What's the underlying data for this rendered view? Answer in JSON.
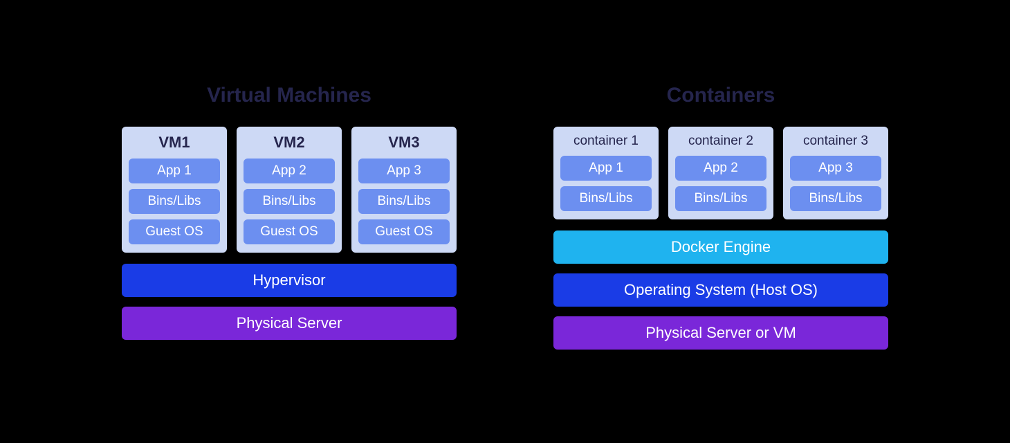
{
  "vm": {
    "title": "Virtual Machines",
    "units": [
      {
        "name": "VM1",
        "app": "App 1",
        "bins": "Bins/Libs",
        "os": "Guest OS"
      },
      {
        "name": "VM2",
        "app": "App 2",
        "bins": "Bins/Libs",
        "os": "Guest OS"
      },
      {
        "name": "VM3",
        "app": "App 3",
        "bins": "Bins/Libs",
        "os": "Guest OS"
      }
    ],
    "hypervisor": "Hypervisor",
    "server": "Physical Server"
  },
  "ctr": {
    "title": "Containers",
    "units": [
      {
        "name": "container 1",
        "app": "App 1",
        "bins": "Bins/Libs"
      },
      {
        "name": "container 2",
        "app": "App 2",
        "bins": "Bins/Libs"
      },
      {
        "name": "container 3",
        "app": "App 3",
        "bins": "Bins/Libs"
      }
    ],
    "engine": "Docker Engine",
    "os": "Operating System (Host OS)",
    "server": "Physical Server or VM"
  }
}
